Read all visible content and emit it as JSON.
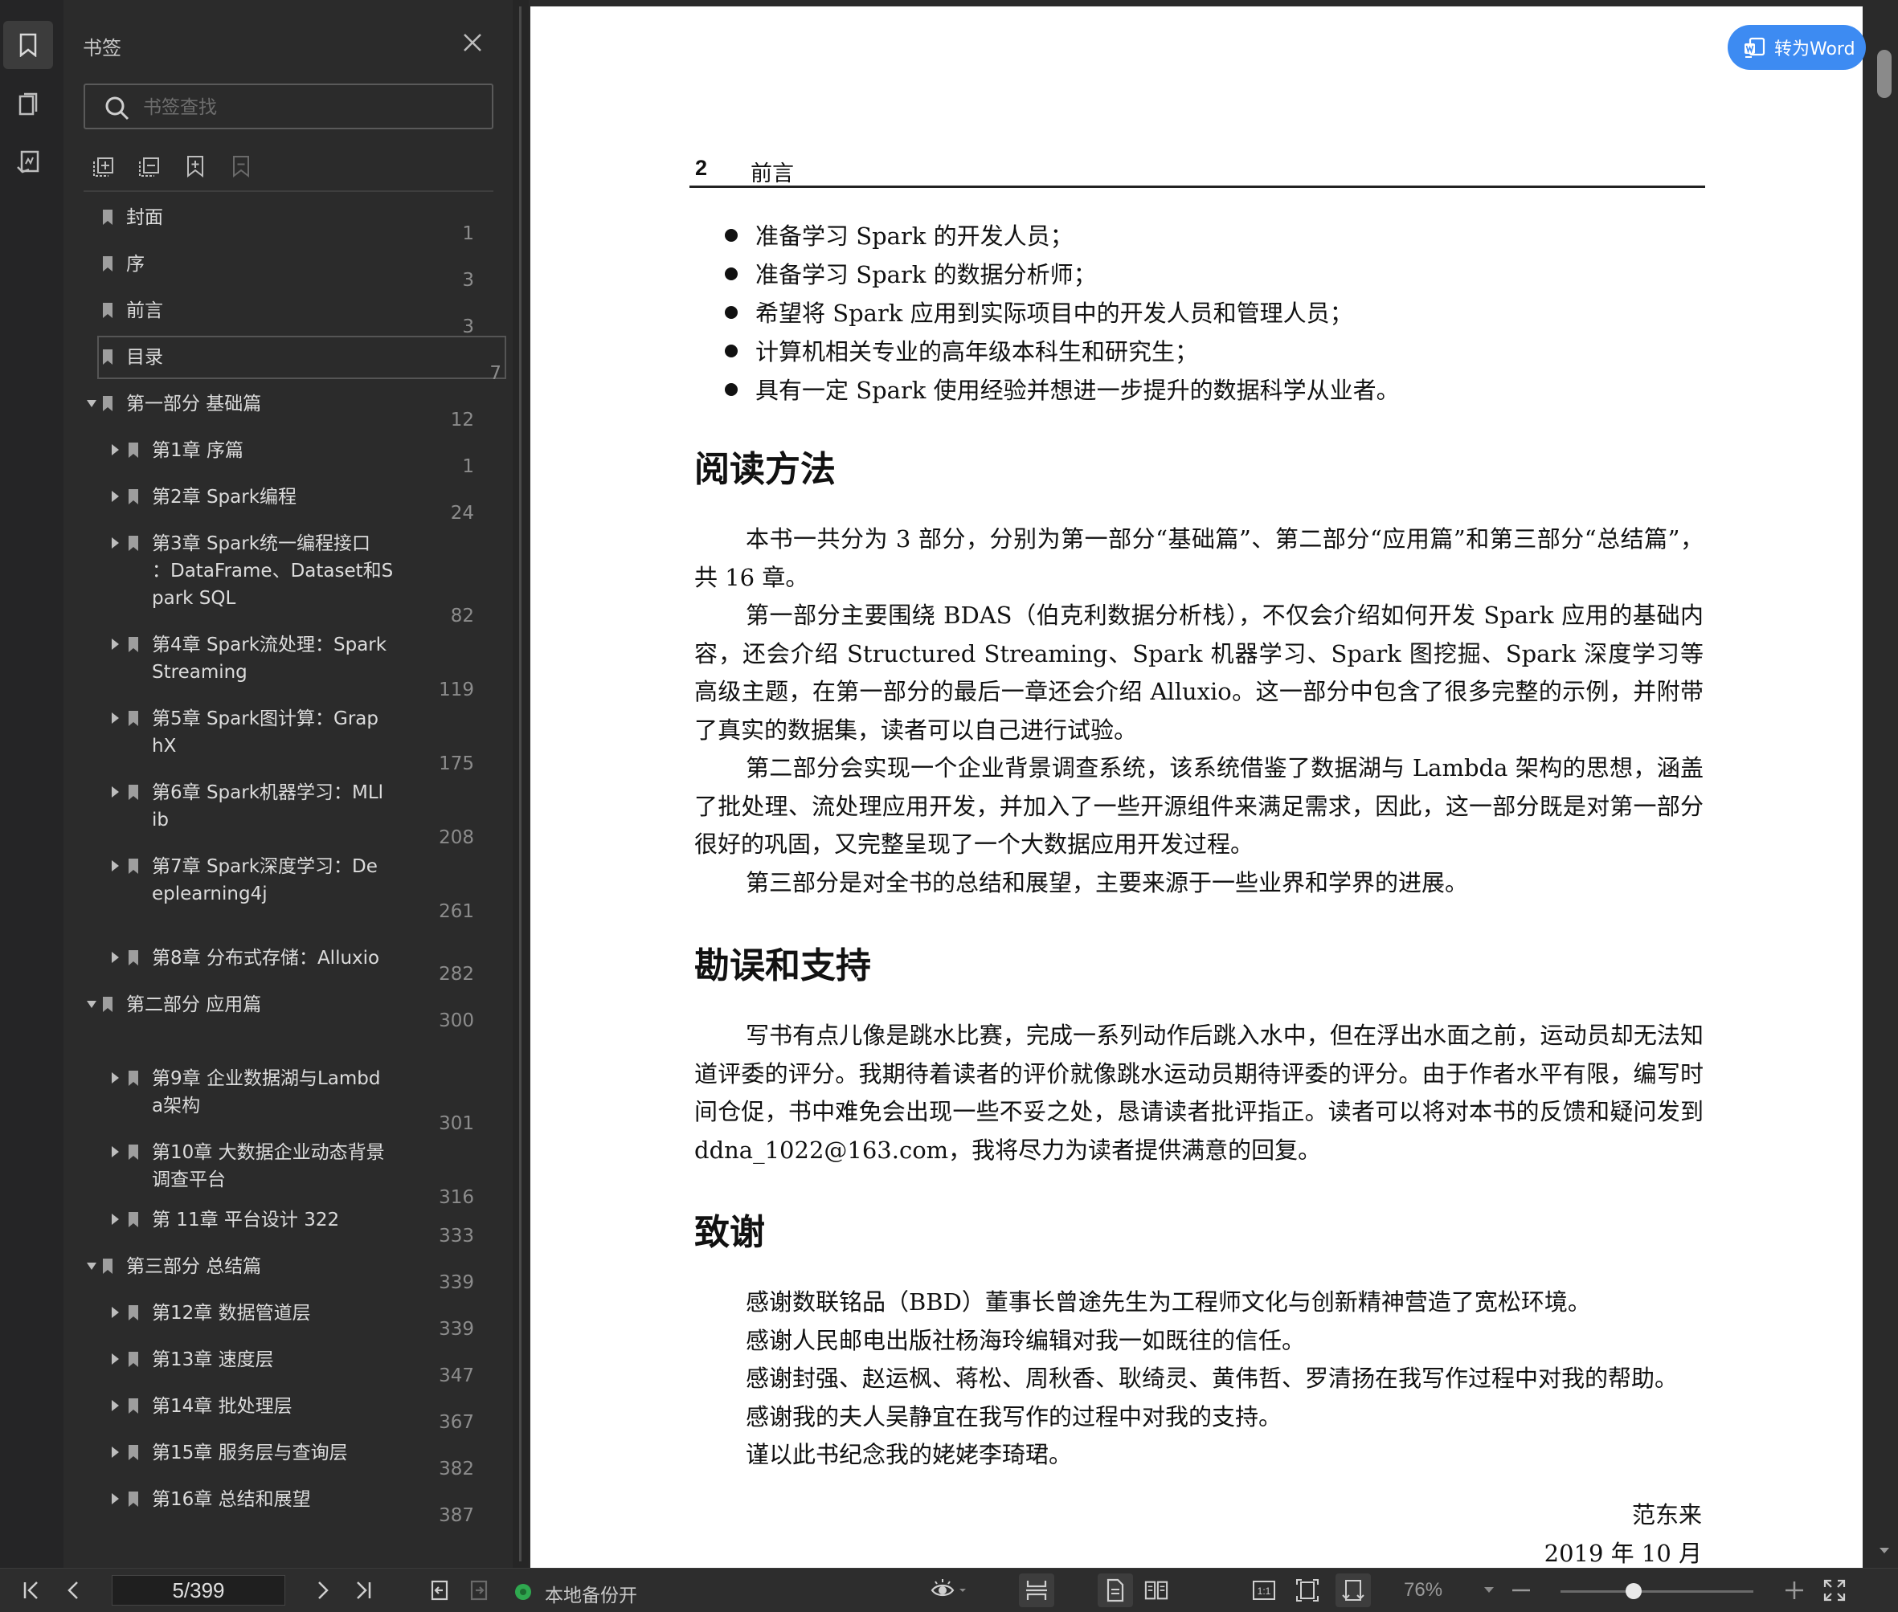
{
  "panel": {
    "title": "书签",
    "search_placeholder": "书签查找"
  },
  "bookmarks": [
    {
      "label": "封面",
      "page": "1",
      "level": 0,
      "expander": "none"
    },
    {
      "label": "序",
      "page": "3",
      "level": 0,
      "expander": "none"
    },
    {
      "label": "前言",
      "page": "3",
      "level": 0,
      "expander": "none"
    },
    {
      "label": "目录",
      "page": "7",
      "level": 0,
      "expander": "none",
      "selected": true
    },
    {
      "label": "第一部分 基础篇",
      "page": "12",
      "level": 0,
      "expander": "expanded"
    },
    {
      "label": "第1章 序篇",
      "page": "1",
      "level": 1,
      "expander": "collapsed"
    },
    {
      "label": "第2章 Spark编程",
      "page": "24",
      "level": 1,
      "expander": "collapsed"
    },
    {
      "label": "第3章 Spark统一编程接口\n：DataFrame、Dataset和S\npark SQL",
      "page": "82",
      "level": 1,
      "expander": "collapsed"
    },
    {
      "label": "第4章 Spark流处理：Spark\nStreaming",
      "page": "119",
      "level": 1,
      "expander": "collapsed"
    },
    {
      "label": "第5章 Spark图计算：Grap\nhX",
      "page": "175",
      "level": 1,
      "expander": "collapsed"
    },
    {
      "label": "第6章 Spark机器学习：MLl\nib",
      "page": "208",
      "level": 1,
      "expander": "collapsed"
    },
    {
      "label": "第7章 Spark深度学习：De\neplearning4j",
      "page": "261",
      "level": 1,
      "expander": "collapsed"
    },
    {
      "label": "第8章 分布式存储：Alluxio",
      "page": "282",
      "level": 1,
      "expander": "collapsed"
    },
    {
      "label": "第二部分 应用篇",
      "page": "300",
      "level": 0,
      "expander": "expanded"
    },
    {
      "label": "第9章 企业数据湖与Lambd\na架构",
      "page": "301",
      "level": 1,
      "expander": "collapsed"
    },
    {
      "label": "第10章 大数据企业动态背景\n调查平台",
      "page": "316",
      "level": 1,
      "expander": "collapsed"
    },
    {
      "label": "第 11章 平台设计 322",
      "page": "333",
      "level": 1,
      "expander": "collapsed"
    },
    {
      "label": "第三部分 总结篇",
      "page": "339",
      "level": 0,
      "expander": "expanded"
    },
    {
      "label": "第12章 数据管道层",
      "page": "339",
      "level": 1,
      "expander": "collapsed"
    },
    {
      "label": "第13章 速度层",
      "page": "347",
      "level": 1,
      "expander": "collapsed"
    },
    {
      "label": "第14章 批处理层",
      "page": "367",
      "level": 1,
      "expander": "collapsed"
    },
    {
      "label": "第15章 服务层与查询层",
      "page": "382",
      "level": 1,
      "expander": "collapsed"
    },
    {
      "label": "第16章 总结和展望",
      "page": "387",
      "level": 1,
      "expander": "collapsed"
    }
  ],
  "doc": {
    "convert_button": "转为Word",
    "header_number": "2",
    "header_title": "前言",
    "bullets": [
      "准备学习 Spark 的开发人员；",
      "准备学习 Spark 的数据分析师；",
      "希望将 Spark 应用到实际项目中的开发人员和管理人员；",
      "计算机相关专业的高年级本科生和研究生；",
      "具有一定 Spark 使用经验并想进一步提升的数据科学从业者。"
    ],
    "h_reading": "阅读方法",
    "reading_p1": "本书一共分为 3 部分，分别为第一部分“基础篇”、第二部分“应用篇”和第三部分“总结篇”，共 16 章。",
    "reading_p2": "第一部分主要围绕 BDAS（伯克利数据分析栈），不仅会介绍如何开发 Spark 应用的基础内容，还会介绍 Structured Streaming、Spark 机器学习、Spark 图挖掘、Spark 深度学习等高级主题，在第一部分的最后一章还会介绍 Alluxio。这一部分中包含了很多完整的示例，并附带了真实的数据集，读者可以自己进行试验。",
    "reading_p3": "第二部分会实现一个企业背景调查系统，该系统借鉴了数据湖与 Lambda 架构的思想，涵盖了批处理、流处理应用开发，并加入了一些开源组件来满足需求，因此，这一部分既是对第一部分很好的巩固，又完整呈现了一个大数据应用开发过程。",
    "reading_p4": "第三部分是对全书的总结和展望，主要来源于一些业界和学界的进展。",
    "h_errata": "勘误和支持",
    "errata_p1": "写书有点儿像是跳水比赛，完成一系列动作后跳入水中，但在浮出水面之前，运动员却无法知道评委的评分。我期待着读者的评价就像跳水运动员期待评委的评分。由于作者水平有限，编写时间仓促，书中难免会出现一些不妥之处，恳请读者批评指正。读者可以将对本书的反馈和疑问发到 ddna_1022@163.com，我将尽力为读者提供满意的回复。",
    "h_thanks": "致谢",
    "thanks": [
      "感谢数联铭品（BBD）董事长曾途先生为工程师文化与创新精神营造了宽松环境。",
      "感谢人民邮电出版社杨海玲编辑对我一如既往的信任。",
      "感谢封强、赵运枫、蒋松、周秋香、耿绮灵、黄伟哲、罗清扬在我写作过程中对我的帮助。",
      "感谢我的夫人吴静宜在我写作的过程中对我的支持。",
      "谨以此书纪念我的姥姥李琦珺。"
    ],
    "signature": "范东来",
    "date": "2019 年 10 月"
  },
  "bottombar": {
    "page_indicator": "5/399",
    "backup_status": "本地备份开",
    "zoom": "76%"
  }
}
